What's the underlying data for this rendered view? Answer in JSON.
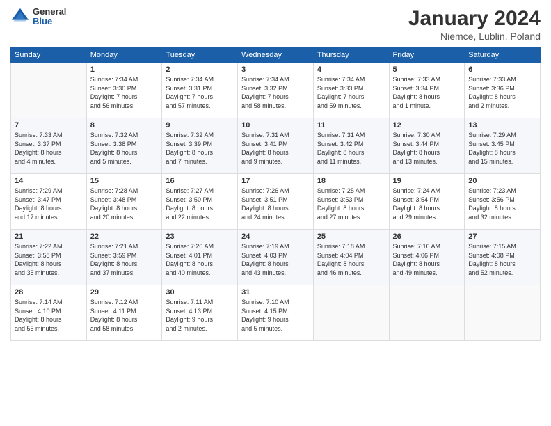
{
  "logo": {
    "general": "General",
    "blue": "Blue"
  },
  "title": "January 2024",
  "subtitle": "Niemce, Lublin, Poland",
  "days_of_week": [
    "Sunday",
    "Monday",
    "Tuesday",
    "Wednesday",
    "Thursday",
    "Friday",
    "Saturday"
  ],
  "weeks": [
    [
      {
        "day": "",
        "info": ""
      },
      {
        "day": "1",
        "info": "Sunrise: 7:34 AM\nSunset: 3:30 PM\nDaylight: 7 hours\nand 56 minutes."
      },
      {
        "day": "2",
        "info": "Sunrise: 7:34 AM\nSunset: 3:31 PM\nDaylight: 7 hours\nand 57 minutes."
      },
      {
        "day": "3",
        "info": "Sunrise: 7:34 AM\nSunset: 3:32 PM\nDaylight: 7 hours\nand 58 minutes."
      },
      {
        "day": "4",
        "info": "Sunrise: 7:34 AM\nSunset: 3:33 PM\nDaylight: 7 hours\nand 59 minutes."
      },
      {
        "day": "5",
        "info": "Sunrise: 7:33 AM\nSunset: 3:34 PM\nDaylight: 8 hours\nand 1 minute."
      },
      {
        "day": "6",
        "info": "Sunrise: 7:33 AM\nSunset: 3:36 PM\nDaylight: 8 hours\nand 2 minutes."
      }
    ],
    [
      {
        "day": "7",
        "info": "Sunrise: 7:33 AM\nSunset: 3:37 PM\nDaylight: 8 hours\nand 4 minutes."
      },
      {
        "day": "8",
        "info": "Sunrise: 7:32 AM\nSunset: 3:38 PM\nDaylight: 8 hours\nand 5 minutes."
      },
      {
        "day": "9",
        "info": "Sunrise: 7:32 AM\nSunset: 3:39 PM\nDaylight: 8 hours\nand 7 minutes."
      },
      {
        "day": "10",
        "info": "Sunrise: 7:31 AM\nSunset: 3:41 PM\nDaylight: 8 hours\nand 9 minutes."
      },
      {
        "day": "11",
        "info": "Sunrise: 7:31 AM\nSunset: 3:42 PM\nDaylight: 8 hours\nand 11 minutes."
      },
      {
        "day": "12",
        "info": "Sunrise: 7:30 AM\nSunset: 3:44 PM\nDaylight: 8 hours\nand 13 minutes."
      },
      {
        "day": "13",
        "info": "Sunrise: 7:29 AM\nSunset: 3:45 PM\nDaylight: 8 hours\nand 15 minutes."
      }
    ],
    [
      {
        "day": "14",
        "info": "Sunrise: 7:29 AM\nSunset: 3:47 PM\nDaylight: 8 hours\nand 17 minutes."
      },
      {
        "day": "15",
        "info": "Sunrise: 7:28 AM\nSunset: 3:48 PM\nDaylight: 8 hours\nand 20 minutes."
      },
      {
        "day": "16",
        "info": "Sunrise: 7:27 AM\nSunset: 3:50 PM\nDaylight: 8 hours\nand 22 minutes."
      },
      {
        "day": "17",
        "info": "Sunrise: 7:26 AM\nSunset: 3:51 PM\nDaylight: 8 hours\nand 24 minutes."
      },
      {
        "day": "18",
        "info": "Sunrise: 7:25 AM\nSunset: 3:53 PM\nDaylight: 8 hours\nand 27 minutes."
      },
      {
        "day": "19",
        "info": "Sunrise: 7:24 AM\nSunset: 3:54 PM\nDaylight: 8 hours\nand 29 minutes."
      },
      {
        "day": "20",
        "info": "Sunrise: 7:23 AM\nSunset: 3:56 PM\nDaylight: 8 hours\nand 32 minutes."
      }
    ],
    [
      {
        "day": "21",
        "info": "Sunrise: 7:22 AM\nSunset: 3:58 PM\nDaylight: 8 hours\nand 35 minutes."
      },
      {
        "day": "22",
        "info": "Sunrise: 7:21 AM\nSunset: 3:59 PM\nDaylight: 8 hours\nand 37 minutes."
      },
      {
        "day": "23",
        "info": "Sunrise: 7:20 AM\nSunset: 4:01 PM\nDaylight: 8 hours\nand 40 minutes."
      },
      {
        "day": "24",
        "info": "Sunrise: 7:19 AM\nSunset: 4:03 PM\nDaylight: 8 hours\nand 43 minutes."
      },
      {
        "day": "25",
        "info": "Sunrise: 7:18 AM\nSunset: 4:04 PM\nDaylight: 8 hours\nand 46 minutes."
      },
      {
        "day": "26",
        "info": "Sunrise: 7:16 AM\nSunset: 4:06 PM\nDaylight: 8 hours\nand 49 minutes."
      },
      {
        "day": "27",
        "info": "Sunrise: 7:15 AM\nSunset: 4:08 PM\nDaylight: 8 hours\nand 52 minutes."
      }
    ],
    [
      {
        "day": "28",
        "info": "Sunrise: 7:14 AM\nSunset: 4:10 PM\nDaylight: 8 hours\nand 55 minutes."
      },
      {
        "day": "29",
        "info": "Sunrise: 7:12 AM\nSunset: 4:11 PM\nDaylight: 8 hours\nand 58 minutes."
      },
      {
        "day": "30",
        "info": "Sunrise: 7:11 AM\nSunset: 4:13 PM\nDaylight: 9 hours\nand 2 minutes."
      },
      {
        "day": "31",
        "info": "Sunrise: 7:10 AM\nSunset: 4:15 PM\nDaylight: 9 hours\nand 5 minutes."
      },
      {
        "day": "",
        "info": ""
      },
      {
        "day": "",
        "info": ""
      },
      {
        "day": "",
        "info": ""
      }
    ]
  ]
}
